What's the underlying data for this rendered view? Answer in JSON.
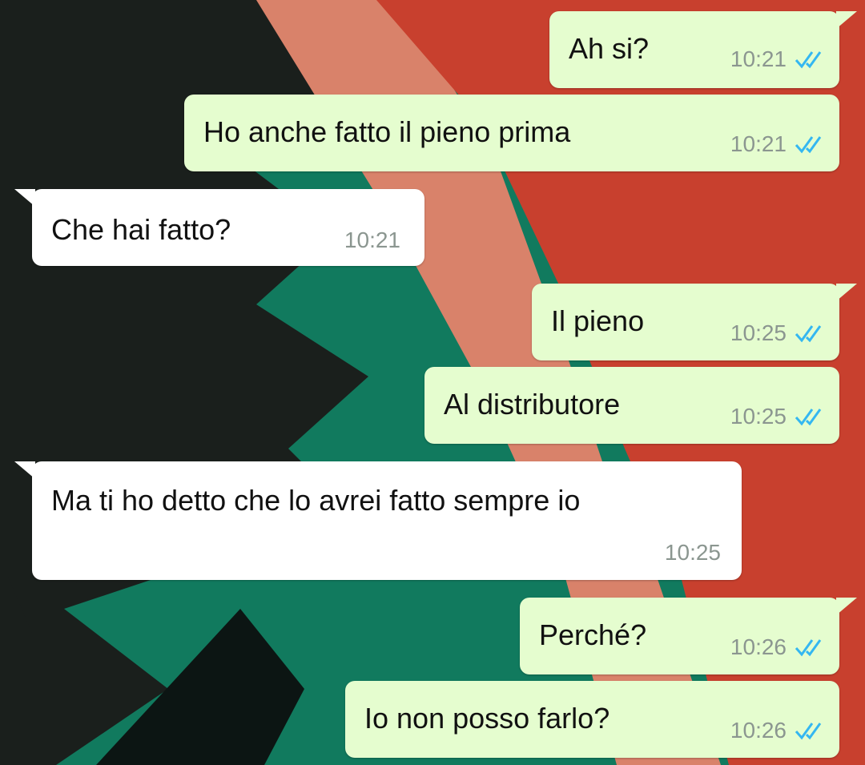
{
  "conversation": {
    "messages": [
      {
        "text": "Ah si?",
        "time": "10:21",
        "direction": "outgoing",
        "status": "read"
      },
      {
        "text": "Ho anche fatto il pieno prima",
        "time": "10:21",
        "direction": "outgoing",
        "status": "read"
      },
      {
        "text": "Che hai fatto?",
        "time": "10:21",
        "direction": "incoming"
      },
      {
        "text": "Il pieno",
        "time": "10:25",
        "direction": "outgoing",
        "status": "read"
      },
      {
        "text": "Al distributore",
        "time": "10:25",
        "direction": "outgoing",
        "status": "read"
      },
      {
        "text": "Ma ti ho detto che lo avrei fatto sempre io",
        "time": "10:25",
        "direction": "incoming"
      },
      {
        "text": "Perché?",
        "time": "10:26",
        "direction": "outgoing",
        "status": "read"
      },
      {
        "text": "Io non posso farlo?",
        "time": "10:26",
        "direction": "outgoing",
        "status": "read"
      }
    ]
  },
  "icons": {
    "read_receipt": "double-check-icon"
  },
  "colors": {
    "outgoing_bubble": "#e5fdcf",
    "incoming_bubble": "#ffffff",
    "read_ticks": "#34b7f1",
    "timestamp": "#8b9690",
    "wallpaper_black": "#1a1f1c",
    "wallpaper_green": "#117a5e",
    "wallpaper_salmon": "#d9826a",
    "wallpaper_red": "#c8402e"
  }
}
